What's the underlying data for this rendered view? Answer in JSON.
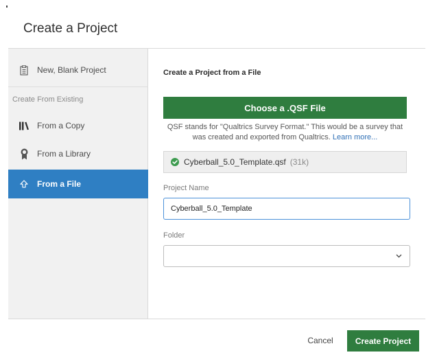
{
  "modal": {
    "title": "Create a Project"
  },
  "sidebar": {
    "blank_project": {
      "label": "New, Blank Project",
      "icon": "clipboard-icon"
    },
    "section_label": "Create From Existing",
    "items": [
      {
        "label": "From a Copy",
        "icon": "library-books-icon"
      },
      {
        "label": "From a Library",
        "icon": "award-ribbon-icon"
      },
      {
        "label": "From a File",
        "icon": "upload-arrow-icon",
        "selected": true
      }
    ]
  },
  "main": {
    "heading": "Create a Project from a File",
    "choose_button": "Choose a .QSF File",
    "description": "QSF stands for \"Qualtrics Survey Format.\" This would be a survey that was created and exported from Qualtrics.",
    "learn_more": "Learn more...",
    "file": {
      "name": "Cyberball_5.0_Template.qsf",
      "size": "(31k)",
      "status_icon": "check-circle-icon",
      "status_color": "#3d9b4f"
    },
    "project_name": {
      "label": "Project Name",
      "value": "Cyberball_5.0_Template"
    },
    "folder": {
      "label": "Folder",
      "value": ""
    }
  },
  "footer": {
    "cancel": "Cancel",
    "create": "Create Project"
  },
  "colors": {
    "accent_blue": "#2f7fc3",
    "primary_green": "#2f7d3f",
    "link": "#2f6fb5"
  }
}
